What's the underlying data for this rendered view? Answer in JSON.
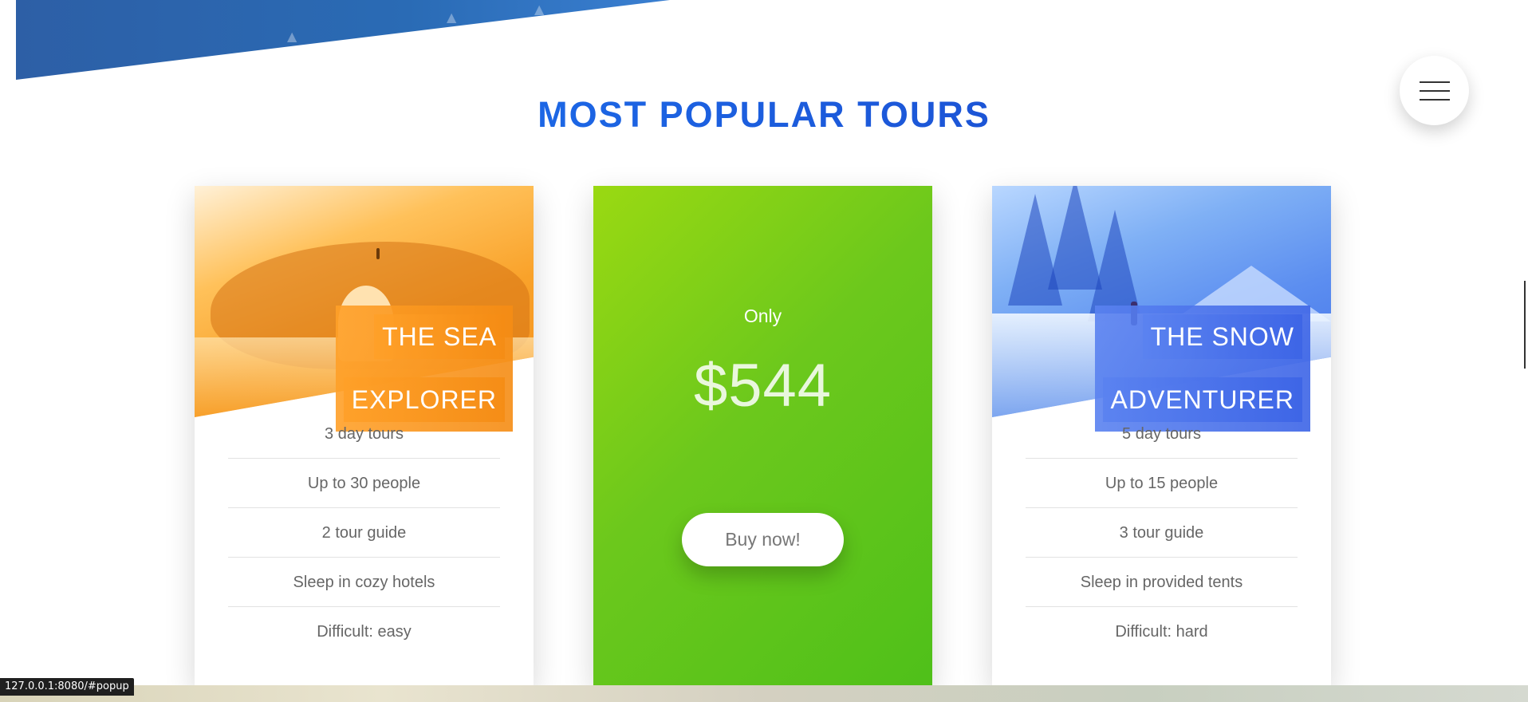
{
  "section": {
    "title": "MOST POPULAR TOURS"
  },
  "nav": {
    "menu_icon": "hamburger-icon"
  },
  "cards": {
    "sea": {
      "title_line1": "THE SEA",
      "title_line2": "EXPLORER",
      "details": [
        "3 day tours",
        "Up to 30 people",
        "2 tour guide",
        "Sleep in cozy hotels",
        "Difficult: easy"
      ]
    },
    "offer": {
      "only_label": "Only",
      "price": "$544",
      "button_label": "Buy now!"
    },
    "snow": {
      "title_line1": "THE SNOW",
      "title_line2": "ADVENTURER",
      "details": [
        "5 day tours",
        "Up to 15 people",
        "3 tour guide",
        "Sleep in provided tents",
        "Difficult: hard"
      ]
    }
  },
  "status_bar": {
    "url": "127.0.0.1:8080/#popup"
  },
  "colors": {
    "heading_gradient_start": "#1e7cf7",
    "heading_gradient_end": "#1a3fc4",
    "sea_accent": "#f4901b",
    "snow_accent": "#3f6ee6",
    "offer_green": "#6cc81c"
  }
}
